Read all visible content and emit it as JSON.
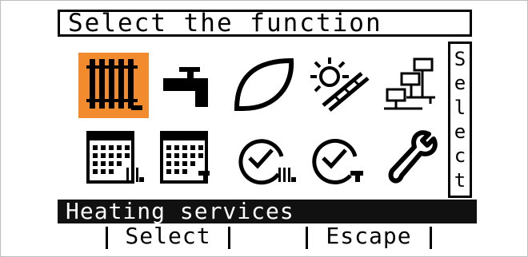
{
  "screen": {
    "title": "Select the function",
    "side_label_chars": [
      "S",
      "e",
      "l",
      "e",
      "c",
      "t"
    ],
    "status_text": "Heating services",
    "softkeys": [
      "",
      "Select",
      "",
      "Escape",
      ""
    ]
  },
  "icons": [
    {
      "name": "radiator-icon",
      "selected": true
    },
    {
      "name": "tap-icon",
      "selected": false
    },
    {
      "name": "leaf-icon",
      "selected": false
    },
    {
      "name": "solar-panel-icon",
      "selected": false
    },
    {
      "name": "network-icon",
      "selected": false
    },
    {
      "name": "heating-calendar-icon",
      "selected": false
    },
    {
      "name": "water-calendar-icon",
      "selected": false
    },
    {
      "name": "heating-clock-icon",
      "selected": false
    },
    {
      "name": "water-clock-icon",
      "selected": false
    },
    {
      "name": "wrench-icon",
      "selected": false
    }
  ],
  "colors": {
    "selection": "#f28a2e",
    "ink": "#000000",
    "status_bg": "#111111"
  }
}
